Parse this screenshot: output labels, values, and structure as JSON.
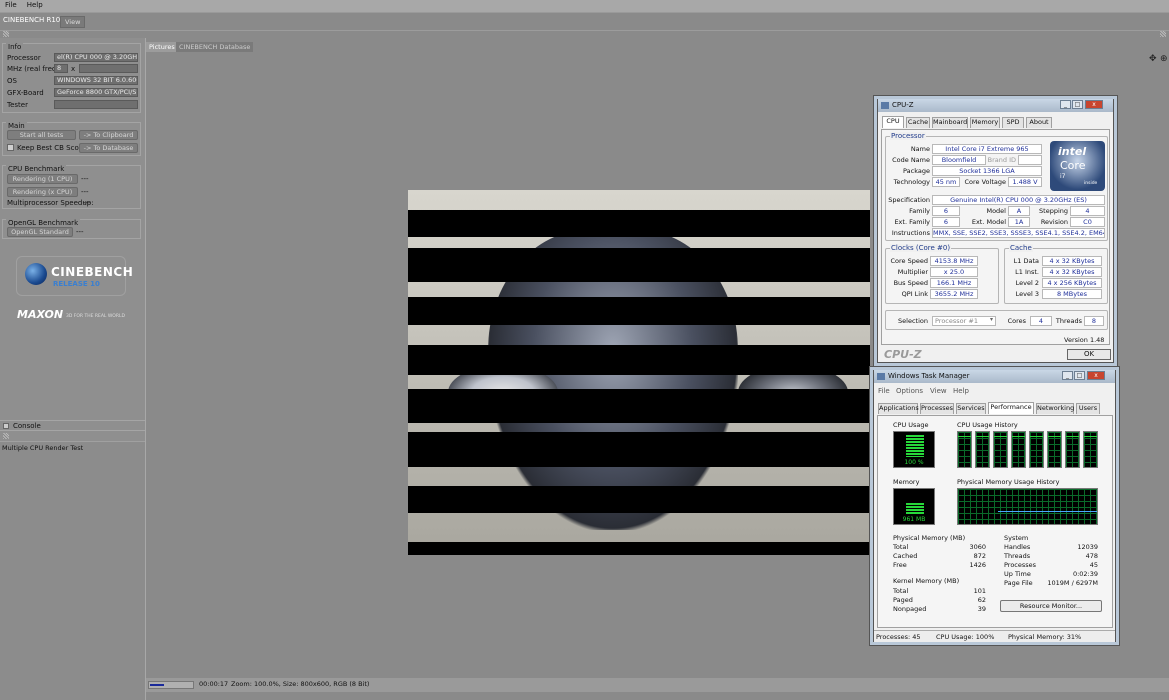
{
  "menu": [
    "File",
    "Help"
  ],
  "app": {
    "title": "CINEBENCH R10",
    "view_tab": "View"
  },
  "info": {
    "section_title": "Info",
    "processor_label": "Processor",
    "processor_value": "el(R) CPU 000 @ 3.20GHz",
    "mhz_label": "MHz (real freq.)",
    "mhz_value": "8",
    "mhz_x": "x",
    "os_label": "OS",
    "os_value": "WINDOWS 32 BIT 6.0.600",
    "gfx_label": "GFX-Board",
    "gfx_value": "GeForce 8800 GTX/PCI/S",
    "tester_label": "Tester"
  },
  "main": {
    "section_title": "Main",
    "start_all": "Start all tests",
    "to_clipboard": "-> To Clipboard",
    "keep_best": "Keep Best CB Score",
    "to_database": "-> To Database"
  },
  "cpu_bench": {
    "section_title": "CPU Benchmark",
    "render_1": "Rendering (1 CPU)",
    "render_1_result": "---",
    "render_x": "Rendering (x CPU)",
    "render_x_result": "---",
    "mp_label": "Multiprocessor Speedup:",
    "mp_result": "---"
  },
  "opengl_bench": {
    "section_title": "OpenGL Benchmark",
    "opengl_std": "OpenGL Standard",
    "opengl_result": "---"
  },
  "logo": {
    "name": "CINEBENCH",
    "release": "RELEASE 10",
    "maxon": "MAXON",
    "tagline": "3D FOR THE REAL WORLD"
  },
  "console": {
    "title": "Console",
    "line": "Multiple CPU Render Test"
  },
  "tabs": {
    "pictures": "Pictures",
    "database": "CINEBENCH Database"
  },
  "status": {
    "time": "00:00:17",
    "info": "Zoom: 100.0%, Size: 800x600, RGB (8 Bit)"
  },
  "cpuz": {
    "title": "CPU-Z",
    "tabs": [
      "CPU",
      "Cache",
      "Mainboard",
      "Memory",
      "SPD",
      "About"
    ],
    "processor_title": "Processor",
    "name_label": "Name",
    "name": "Intel Core i7 Extreme 965",
    "codename_label": "Code Name",
    "codename": "Bloomfield",
    "brand_id_label": "Brand ID",
    "package_label": "Package",
    "package": "Socket 1366 LGA",
    "technology_label": "Technology",
    "technology": "45 nm",
    "core_voltage_label": "Core Voltage",
    "core_voltage": "1.488 V",
    "spec_label": "Specification",
    "spec": "Genuine Intel(R) CPU         000  @ 3.20GHz (ES)",
    "family_label": "Family",
    "family": "6",
    "model_label": "Model",
    "model": "A",
    "stepping_label": "Stepping",
    "stepping": "4",
    "ext_family_label": "Ext. Family",
    "ext_family": "6",
    "ext_model_label": "Ext. Model",
    "ext_model": "1A",
    "revision_label": "Revision",
    "revision": "C0",
    "instructions_label": "Instructions",
    "instructions": "MMX, SSE, SSE2, SSE3, SSSE3, SSE4.1, SSE4.2, EM64T",
    "clocks_title": "Clocks (Core #0)",
    "core_speed_label": "Core Speed",
    "core_speed": "4153.8 MHz",
    "multiplier_label": "Multiplier",
    "multiplier": "x 25.0",
    "bus_speed_label": "Bus Speed",
    "bus_speed": "166.1 MHz",
    "qpi_label": "QPI Link",
    "qpi": "3655.2 MHz",
    "cache_title": "Cache",
    "l1d_label": "L1 Data",
    "l1d": "4 x 32 KBytes",
    "l1i_label": "L1 Inst.",
    "l1i": "4 x 32 KBytes",
    "l2_label": "Level 2",
    "l2": "4 x 256 KBytes",
    "l3_label": "Level 3",
    "l3": "8 MBytes",
    "selection_label": "Selection",
    "selection": "Processor #1",
    "cores_label": "Cores",
    "cores": "4",
    "threads_label": "Threads",
    "threads": "8",
    "version": "Version 1.48",
    "footer_logo": "CPU-Z",
    "ok": "OK",
    "intel_logo_1": "intel",
    "intel_logo_2": "Core",
    "intel_logo_3": "i7",
    "intel_logo_4": "inside"
  },
  "taskman": {
    "title": "Windows Task Manager",
    "menu": [
      "File",
      "Options",
      "View",
      "Help"
    ],
    "tabs": [
      "Applications",
      "Processes",
      "Services",
      "Performance",
      "Networking",
      "Users"
    ],
    "cpu_usage_label": "CPU Usage",
    "cpu_usage": "100 %",
    "cpu_history_label": "CPU Usage History",
    "memory_label": "Memory",
    "memory": "961 MB",
    "mem_history_label": "Physical Memory Usage History",
    "phys_title": "Physical Memory (MB)",
    "total_label": "Total",
    "total": "3060",
    "cached_label": "Cached",
    "cached": "872",
    "free_label": "Free",
    "free": "1426",
    "kernel_title": "Kernel Memory (MB)",
    "k_total_label": "Total",
    "k_total": "101",
    "paged_label": "Paged",
    "paged": "62",
    "nonpaged_label": "Nonpaged",
    "nonpaged": "39",
    "system_title": "System",
    "handles_label": "Handles",
    "handles": "12039",
    "threads_label": "Threads",
    "threads": "478",
    "processes_label": "Processes",
    "processes": "45",
    "uptime_label": "Up Time",
    "uptime": "0:02:39",
    "pagefile_label": "Page File",
    "pagefile": "1019M / 6297M",
    "resource_monitor": "Resource Monitor...",
    "status_processes": "Processes: 45",
    "status_cpu": "CPU Usage: 100%",
    "status_mem": "Physical Memory: 31%"
  }
}
